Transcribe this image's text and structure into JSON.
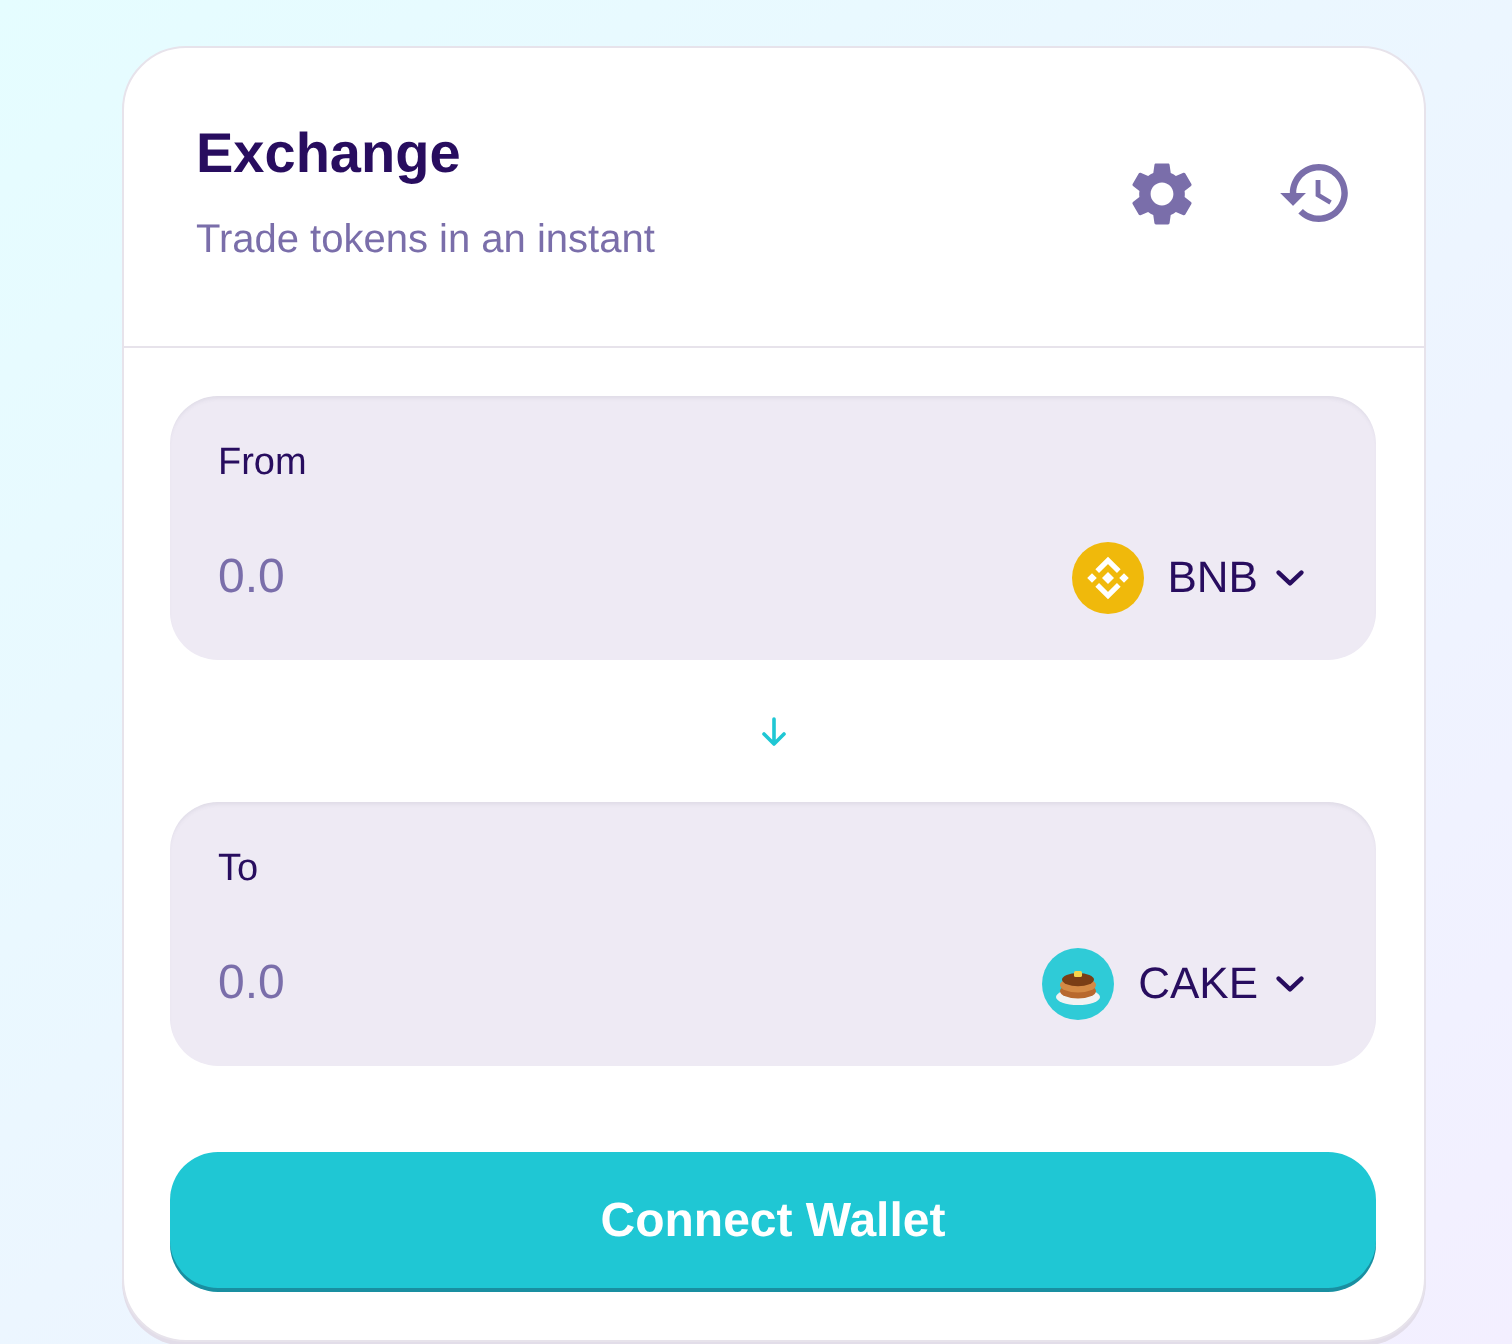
{
  "header": {
    "title": "Exchange",
    "subtitle": "Trade tokens in an instant"
  },
  "panels": [
    {
      "label": "From",
      "placeholder": "0.0",
      "token": {
        "symbol": "BNB",
        "kind": "bnb"
      }
    },
    {
      "label": "To",
      "placeholder": "0.0",
      "token": {
        "symbol": "CAKE",
        "kind": "cake"
      }
    }
  ],
  "button": {
    "label": "Connect Wallet"
  }
}
